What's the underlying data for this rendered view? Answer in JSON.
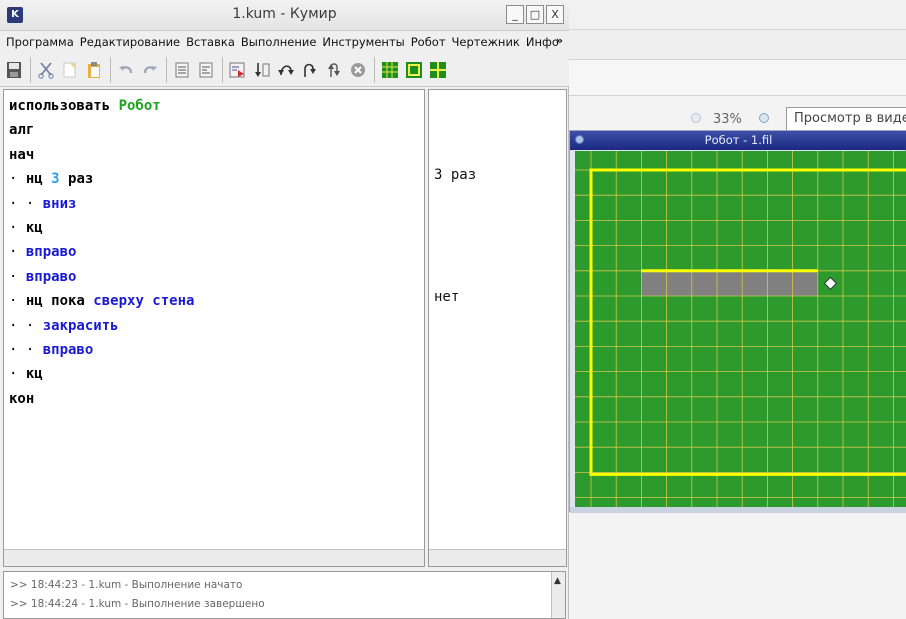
{
  "window": {
    "title": "1.kum - Кумир",
    "app_icon": "K",
    "min_label": "_",
    "max_label": "□",
    "close_label": "X"
  },
  "menubar": {
    "items": [
      {
        "label": "Программа"
      },
      {
        "label": "Редактирование"
      },
      {
        "label": "Вставка"
      },
      {
        "label": "Выполнение"
      },
      {
        "label": "Инструменты"
      },
      {
        "label": "Робот"
      },
      {
        "label": "Чертежник"
      },
      {
        "label": "Инфо"
      }
    ],
    "more": "»"
  },
  "toolbar": {
    "buttons": [
      {
        "name": "save-icon"
      },
      {
        "name": "cut-icon"
      },
      {
        "name": "copy-icon"
      },
      {
        "name": "paste-icon"
      },
      {
        "name": "undo-icon"
      },
      {
        "name": "redo-icon"
      },
      {
        "name": "comment-icon"
      },
      {
        "name": "uncomment-icon"
      },
      {
        "name": "run-icon"
      },
      {
        "name": "step-icon"
      },
      {
        "name": "step-into-icon"
      },
      {
        "name": "step-out-icon"
      },
      {
        "name": "run-to-end-icon"
      },
      {
        "name": "stop-icon"
      },
      {
        "name": "robot-field-icon"
      },
      {
        "name": "robot-window-icon"
      },
      {
        "name": "robot-control-icon"
      }
    ]
  },
  "editor": {
    "lines": [
      {
        "indent": "",
        "parts": [
          {
            "t": "использовать ",
            "c": "kw"
          },
          {
            "t": "Робот",
            "c": "green"
          }
        ]
      },
      {
        "indent": "",
        "parts": [
          {
            "t": "алг",
            "c": "kw"
          }
        ]
      },
      {
        "indent": "",
        "parts": [
          {
            "t": "нач",
            "c": "kw"
          }
        ]
      },
      {
        "indent": "· ",
        "parts": [
          {
            "t": "нц ",
            "c": "kw"
          },
          {
            "t": "3",
            "c": "cyan"
          },
          {
            "t": " раз",
            "c": "kw"
          }
        ]
      },
      {
        "indent": "· · ",
        "parts": [
          {
            "t": "вниз",
            "c": "blue"
          }
        ]
      },
      {
        "indent": "· ",
        "parts": [
          {
            "t": "кц",
            "c": "kw"
          }
        ]
      },
      {
        "indent": "· ",
        "parts": [
          {
            "t": "вправо",
            "c": "blue"
          }
        ]
      },
      {
        "indent": "· ",
        "parts": [
          {
            "t": "вправо",
            "c": "blue"
          }
        ]
      },
      {
        "indent": "· ",
        "parts": [
          {
            "t": "нц пока ",
            "c": "kw"
          },
          {
            "t": "сверху стена",
            "c": "blue"
          }
        ]
      },
      {
        "indent": "· · ",
        "parts": [
          {
            "t": "закрасить",
            "c": "blue"
          }
        ]
      },
      {
        "indent": "· · ",
        "parts": [
          {
            "t": "вправо",
            "c": "blue"
          }
        ]
      },
      {
        "indent": "· ",
        "parts": [
          {
            "t": "кц",
            "c": "kw"
          }
        ]
      },
      {
        "indent": "",
        "parts": [
          {
            "t": "кон",
            "c": "kw"
          }
        ]
      }
    ]
  },
  "margin": {
    "line4": "3 раз",
    "line9": "нет"
  },
  "log": {
    "lines": [
      ">> 18:44:23 - 1.kum - Выполнение начато",
      ">> 18:44:24 - 1.kum - Выполнение завершено"
    ],
    "scroll_up": "▲"
  },
  "robot": {
    "title": "Робот - 1.fil",
    "field_color": "#2c9a2c",
    "wall_color": "#ffff00",
    "painted_color": "#808080",
    "grid_color": "#d2c84a"
  },
  "background_window": {
    "zoom": "33%",
    "view_button": "Просмотр в виде"
  }
}
